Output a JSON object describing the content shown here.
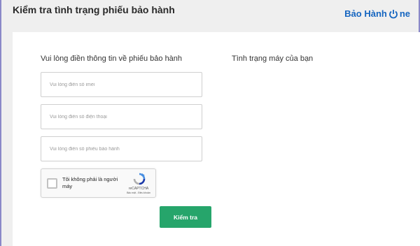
{
  "header": {
    "title": "Kiểm tra tình trạng phiếu bảo hành",
    "brand": {
      "text": "Bảo Hành",
      "suffix": "ne",
      "icon": "power-icon"
    }
  },
  "form": {
    "heading": "Vui lòng điền thông tin về phiếu bảo hành",
    "imei_placeholder": "Vui lòng điền số imei",
    "phone_placeholder": "Vui lòng điền số điện thoại",
    "warranty_placeholder": "Vui lòng điền số phiếu bảo hành",
    "captcha": {
      "label": "Tôi không phải là người máy",
      "brand": "reCAPTCHA",
      "links": "Bảo mật - Điều khoản",
      "icon": "recaptcha-icon"
    },
    "submit_label": "Kiểm tra"
  },
  "status": {
    "heading": "Tình trạng máy của bạn"
  },
  "colors": {
    "accent": "#26a56b",
    "brand": "#1565c0",
    "background": "#efefef"
  }
}
